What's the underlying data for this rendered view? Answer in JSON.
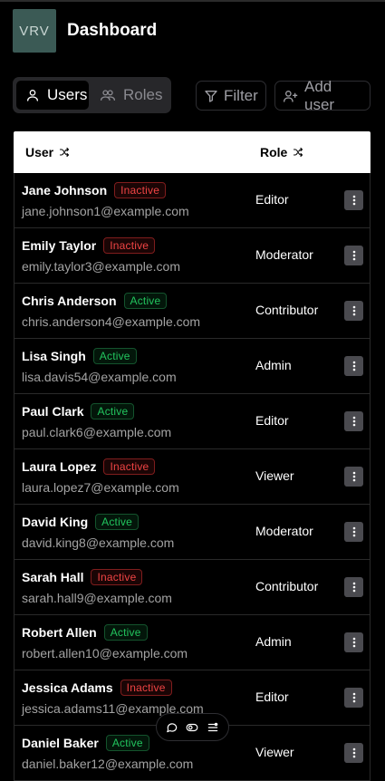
{
  "app": {
    "logo_text": "VRV",
    "title": "Dashboard"
  },
  "toolbar": {
    "tabs": [
      {
        "label": "Users",
        "icon": "user-icon",
        "active": true
      },
      {
        "label": "Roles",
        "icon": "users-icon",
        "active": false
      }
    ],
    "filter_label": "Filter",
    "add_user_label": "Add user"
  },
  "table": {
    "columns": [
      {
        "label": "User",
        "sort_icon": "shuffle-icon"
      },
      {
        "label": "Role",
        "sort_icon": "shuffle-icon"
      }
    ],
    "rows": [
      {
        "name": "Jane Johnson",
        "status": "Inactive",
        "email": "jane.johnson1@example.com",
        "role": "Editor"
      },
      {
        "name": "Emily Taylor",
        "status": "Inactive",
        "email": "emily.taylor3@example.com",
        "role": "Moderator"
      },
      {
        "name": "Chris Anderson",
        "status": "Active",
        "email": "chris.anderson4@example.com",
        "role": "Contributor"
      },
      {
        "name": "Lisa Singh",
        "status": "Active",
        "email": "lisa.davis54@example.com",
        "role": "Admin"
      },
      {
        "name": "Paul Clark",
        "status": "Active",
        "email": "paul.clark6@example.com",
        "role": "Editor"
      },
      {
        "name": "Laura Lopez",
        "status": "Inactive",
        "email": "laura.lopez7@example.com",
        "role": "Viewer"
      },
      {
        "name": "David King",
        "status": "Active",
        "email": "david.king8@example.com",
        "role": "Moderator"
      },
      {
        "name": "Sarah Hall",
        "status": "Inactive",
        "email": "sarah.hall9@example.com",
        "role": "Contributor"
      },
      {
        "name": "Robert Allen",
        "status": "Active",
        "email": "robert.allen10@example.com",
        "role": "Admin"
      },
      {
        "name": "Jessica Adams",
        "status": "Inactive",
        "email": "jessica.adams11@example.com",
        "role": "Editor"
      },
      {
        "name": "Daniel Baker",
        "status": "Active",
        "email": "daniel.baker12@example.com",
        "role": "Viewer"
      }
    ]
  },
  "floating_toolbar": {
    "icons": [
      "comment-icon",
      "toggle-icon",
      "list-icon"
    ]
  },
  "colors": {
    "active": "#22c55e",
    "inactive": "#ef4444",
    "logo_bg": "#3b5a55"
  }
}
